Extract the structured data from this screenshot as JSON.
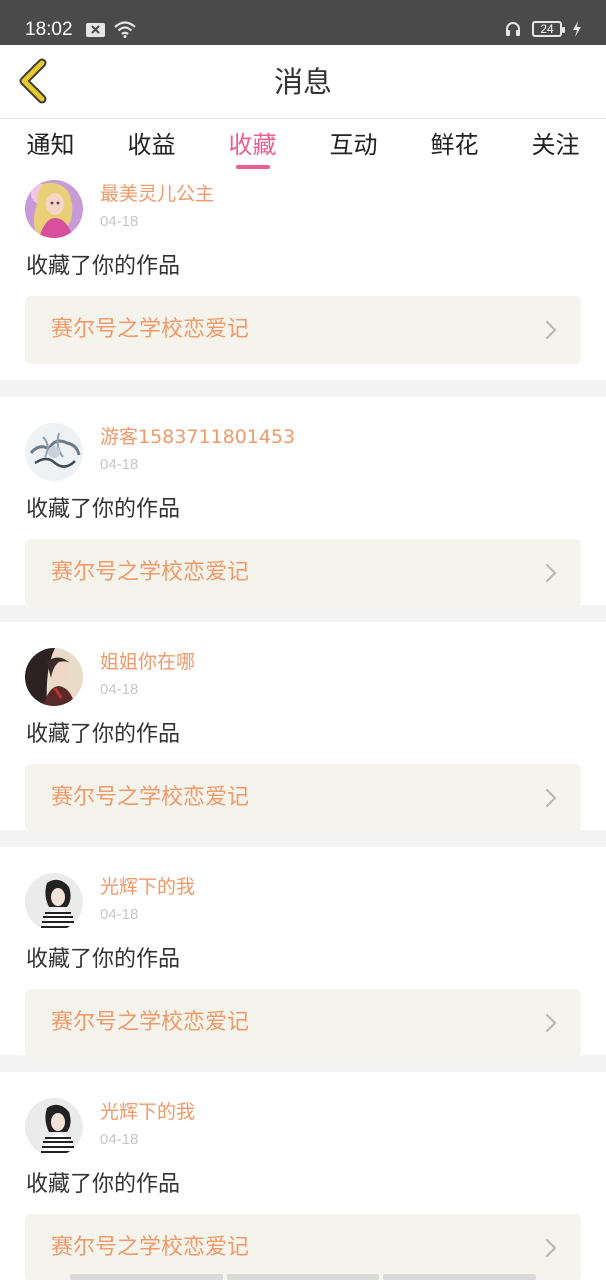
{
  "status_bar": {
    "time": "18:02",
    "battery": "24",
    "icons": [
      "sim-error-icon",
      "wifi-icon",
      "headphones-icon",
      "battery-icon",
      "charging-icon"
    ]
  },
  "nav": {
    "title": "消息",
    "back_icon": "back-chevron-icon",
    "accent_color": "#e9c82c"
  },
  "tabs": [
    {
      "label": "通知",
      "active": false
    },
    {
      "label": "收益",
      "active": false
    },
    {
      "label": "收藏",
      "active": true
    },
    {
      "label": "互动",
      "active": false
    },
    {
      "label": "鲜花",
      "active": false
    },
    {
      "label": "关注",
      "active": false
    }
  ],
  "colors": {
    "tab_active": "#e95f93",
    "username": "#f09a6a",
    "work_title": "#f09a6a",
    "work_box_bg": "#f4f4ec"
  },
  "messages": [
    {
      "user": "最美灵儿公主",
      "date": "04-18",
      "action": "收藏了你的作品",
      "work": "赛尔号之学校恋爱记",
      "avatar": "princess-avatar"
    },
    {
      "user": "游客1583711801453",
      "date": "04-18",
      "action": "收藏了你的作品",
      "work": "赛尔号之学校恋爱记",
      "avatar": "ink-art-avatar"
    },
    {
      "user": "姐姐你在哪",
      "date": "04-18",
      "action": "收藏了你的作品",
      "work": "赛尔号之学校恋爱记",
      "avatar": "girl-dark-avatar"
    },
    {
      "user": "光辉下的我",
      "date": "04-18",
      "action": "收藏了你的作品",
      "work": "赛尔号之学校恋爱记",
      "avatar": "girl-striped-avatar"
    },
    {
      "user": "光辉下的我",
      "date": "04-18",
      "action": "收藏了你的作品",
      "work": "赛尔号之学校恋爱记",
      "avatar": "girl-striped-avatar"
    }
  ]
}
